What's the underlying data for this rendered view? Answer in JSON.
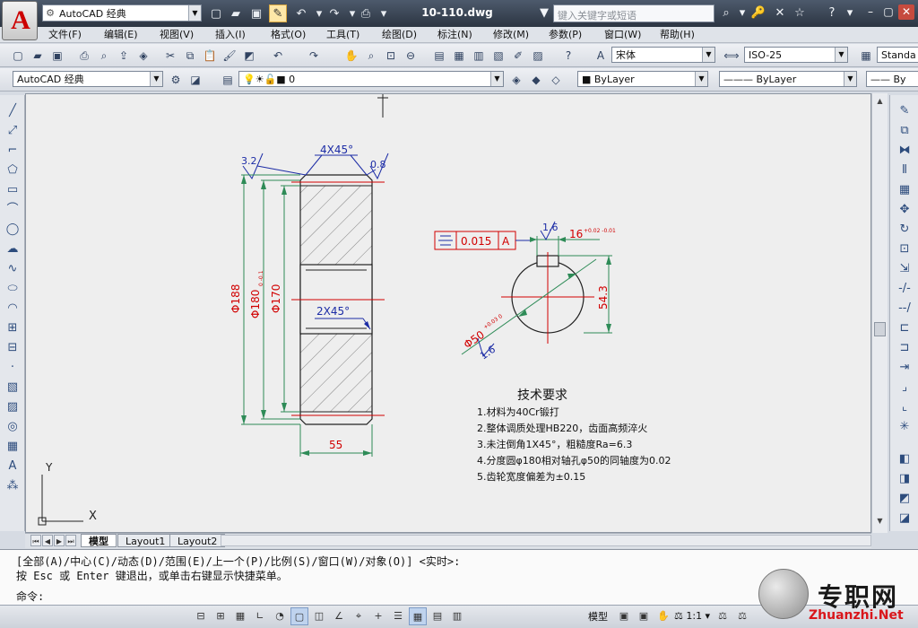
{
  "app": {
    "logo_letter": "A",
    "workspace": "AutoCAD 经典",
    "document_title": "10-110.dwg",
    "search_placeholder": "键入关键字或短语"
  },
  "menu": [
    "文件(F)",
    "编辑(E)",
    "视图(V)",
    "插入(I)",
    "格式(O)",
    "工具(T)",
    "绘图(D)",
    "标注(N)",
    "修改(M)",
    "参数(P)",
    "窗口(W)",
    "帮助(H)"
  ],
  "toolbars": {
    "font_name": "宋体",
    "dim_style": "ISO-25",
    "table_style": "Standa",
    "workspace_combo": "AutoCAD 经典",
    "layer": "0",
    "color": "ByLayer",
    "linetype": "ByLayer",
    "lineweight": "By"
  },
  "drawing": {
    "chamfer_top": "4X45°",
    "rough_left": "3.2",
    "rough_right": "0.8",
    "dia_188": "Φ188",
    "dia_180": "Φ180",
    "dia_180_tol": "0 -0.1",
    "dia_170": "Φ170",
    "chamfer_inner": "2X45°",
    "width_55": "55",
    "tol_value": "0.015",
    "tol_datum": "A",
    "rough_key": "1.6",
    "key_width": "16",
    "key_tol": "+0.02 -0.01",
    "dim_54_3": "54.3",
    "bore_dia": "Φ50",
    "bore_tol": "+0.03 0",
    "rough_bore": "1.6",
    "ucs_y": "Y",
    "ucs_x": "X"
  },
  "tech_requirements": {
    "title": "技术要求",
    "items": [
      "1.材料为40Cr锻打",
      "2.整体调质处理HB220，齿面高频淬火",
      "3.未注倒角1X45°，粗糙度Ra=6.3",
      "4.分度圆φ180相对轴孔φ50的同轴度为0.02",
      "5.齿轮宽度偏差为±0.15"
    ]
  },
  "layout_tabs": [
    "模型",
    "Layout1",
    "Layout2"
  ],
  "command": {
    "line1": "[全部(A)/中心(C)/动态(D)/范围(E)/上一个(P)/比例(S)/窗口(W)/对象(O)] <实时>:",
    "line2": "按 Esc 或 Enter 键退出，或单击右键显示快捷菜单。",
    "prompt": "命令:"
  },
  "status": {
    "model_label": "模型",
    "scale": "1:1"
  },
  "watermark": {
    "text": "专职网",
    "url": "Zhuanzhi.Net"
  },
  "colors": {
    "title_bg": "#2c3542",
    "canvas_bg": "#eeeeee",
    "dim_red": "#d10000",
    "dim_green": "#2e8b57",
    "dim_blue": "#1c2ca6",
    "hatch": "#555555"
  }
}
